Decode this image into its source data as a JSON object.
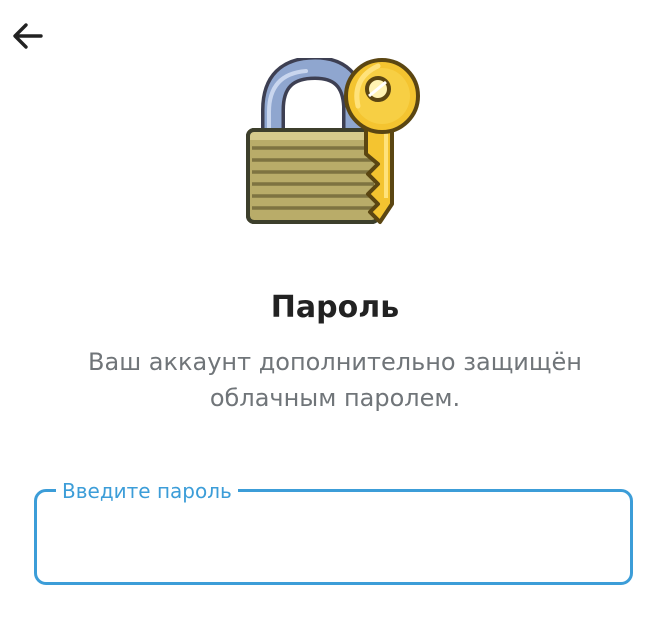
{
  "header": {
    "back_icon": "arrow-left-icon"
  },
  "illustration": {
    "icon": "lock-with-key-icon"
  },
  "main": {
    "title": "Пароль",
    "subtitle": "Ваш аккаунт дополнительно защищён облачным паролем."
  },
  "password_field": {
    "label": "Введите пароль",
    "value": ""
  },
  "colors": {
    "accent": "#3c9dd8",
    "title_text": "#222222",
    "secondary_text": "#707579"
  }
}
